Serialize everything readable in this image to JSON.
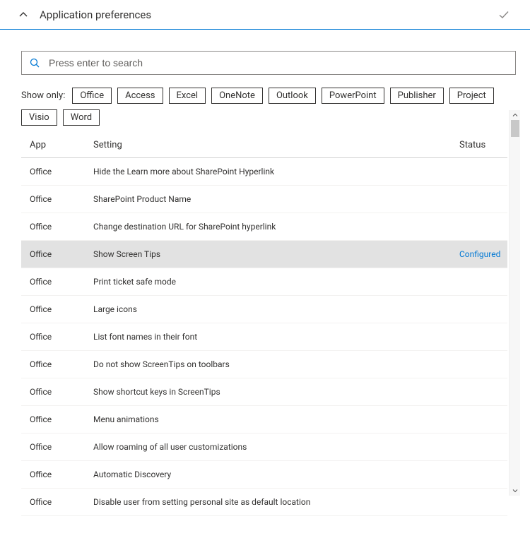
{
  "header": {
    "title": "Application preferences"
  },
  "search": {
    "placeholder": "Press enter to search",
    "value": ""
  },
  "filter": {
    "label": "Show only:",
    "options": [
      "Office",
      "Access",
      "Excel",
      "OneNote",
      "Outlook",
      "PowerPoint",
      "Publisher",
      "Project",
      "Visio",
      "Word"
    ]
  },
  "columns": {
    "app": "App",
    "setting": "Setting",
    "status": "Status"
  },
  "rows": [
    {
      "app": "Office",
      "setting": "Hide the Learn more about SharePoint Hyperlink",
      "status": "",
      "selected": false
    },
    {
      "app": "Office",
      "setting": "SharePoint Product Name",
      "status": "",
      "selected": false
    },
    {
      "app": "Office",
      "setting": "Change destination URL for SharePoint hyperlink",
      "status": "",
      "selected": false
    },
    {
      "app": "Office",
      "setting": "Show Screen Tips",
      "status": "Configured",
      "selected": true
    },
    {
      "app": "Office",
      "setting": "Print ticket safe mode",
      "status": "",
      "selected": false
    },
    {
      "app": "Office",
      "setting": "Large icons",
      "status": "",
      "selected": false
    },
    {
      "app": "Office",
      "setting": "List font names in their font",
      "status": "",
      "selected": false
    },
    {
      "app": "Office",
      "setting": "Do not show ScreenTips on toolbars",
      "status": "",
      "selected": false
    },
    {
      "app": "Office",
      "setting": "Show shortcut keys in ScreenTips",
      "status": "",
      "selected": false
    },
    {
      "app": "Office",
      "setting": "Menu animations",
      "status": "",
      "selected": false
    },
    {
      "app": "Office",
      "setting": "Allow roaming of all user customizations",
      "status": "",
      "selected": false
    },
    {
      "app": "Office",
      "setting": "Automatic Discovery",
      "status": "",
      "selected": false
    },
    {
      "app": "Office",
      "setting": "Disable user from setting personal site as default location",
      "status": "",
      "selected": false
    }
  ]
}
